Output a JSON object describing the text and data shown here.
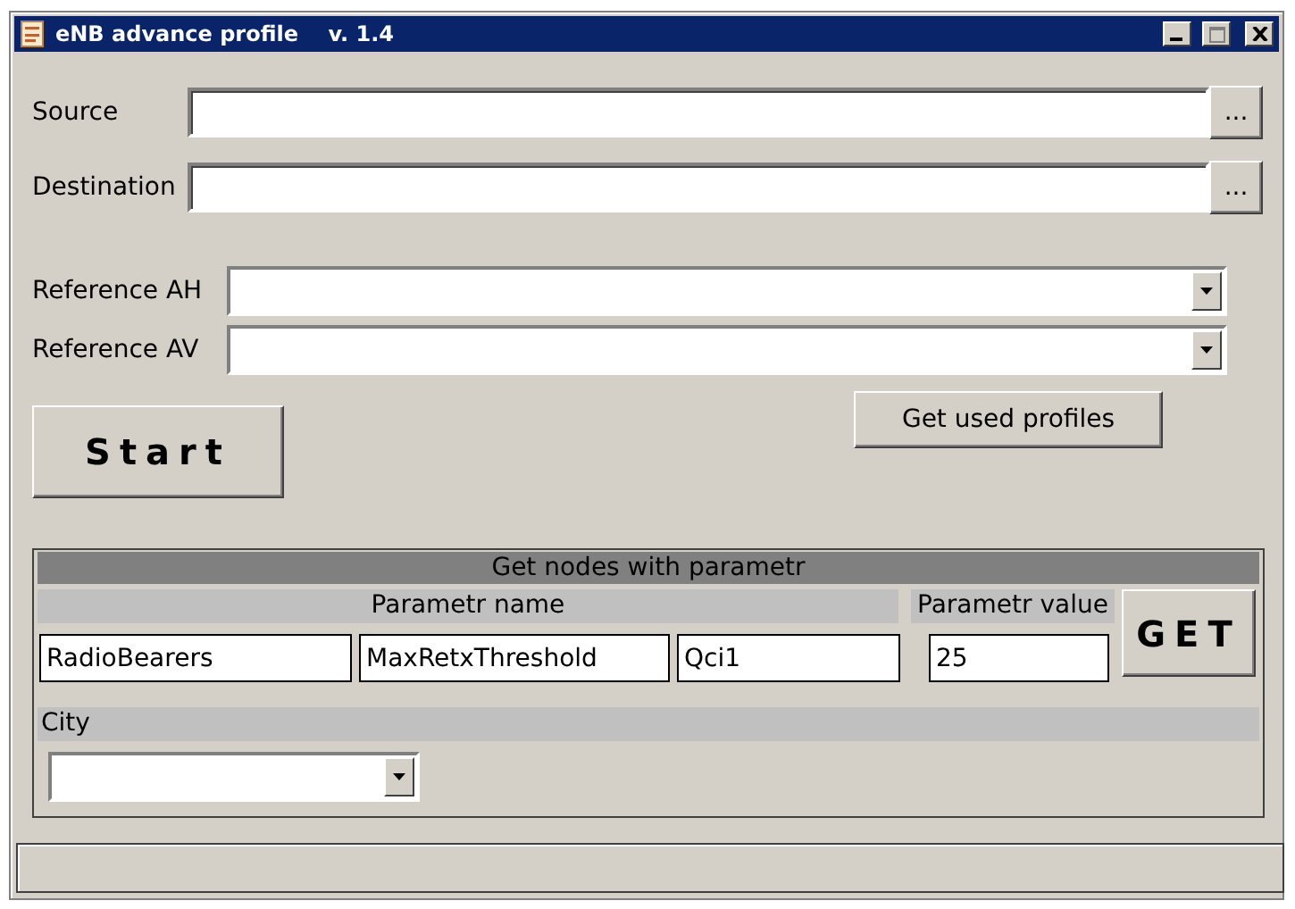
{
  "window": {
    "title": "eNB advance profile    v. 1.4"
  },
  "paths": [
    {
      "label": "Source",
      "browse": "..."
    },
    {
      "label": "Destination",
      "browse": "..."
    }
  ],
  "references": [
    {
      "label": "Reference AH"
    },
    {
      "label": "Reference AV"
    }
  ],
  "start_button": "Start",
  "used_profiles_button": "Get used profiles",
  "parameter_group": {
    "title": "Get nodes with parametr",
    "name_header": "Parametr name",
    "value_header": "Parametr value",
    "name_parts": [
      "RadioBearers",
      "MaxRetxThreshold",
      "Qci1"
    ],
    "value": "25",
    "get_button": "GET",
    "city_label": "City"
  }
}
